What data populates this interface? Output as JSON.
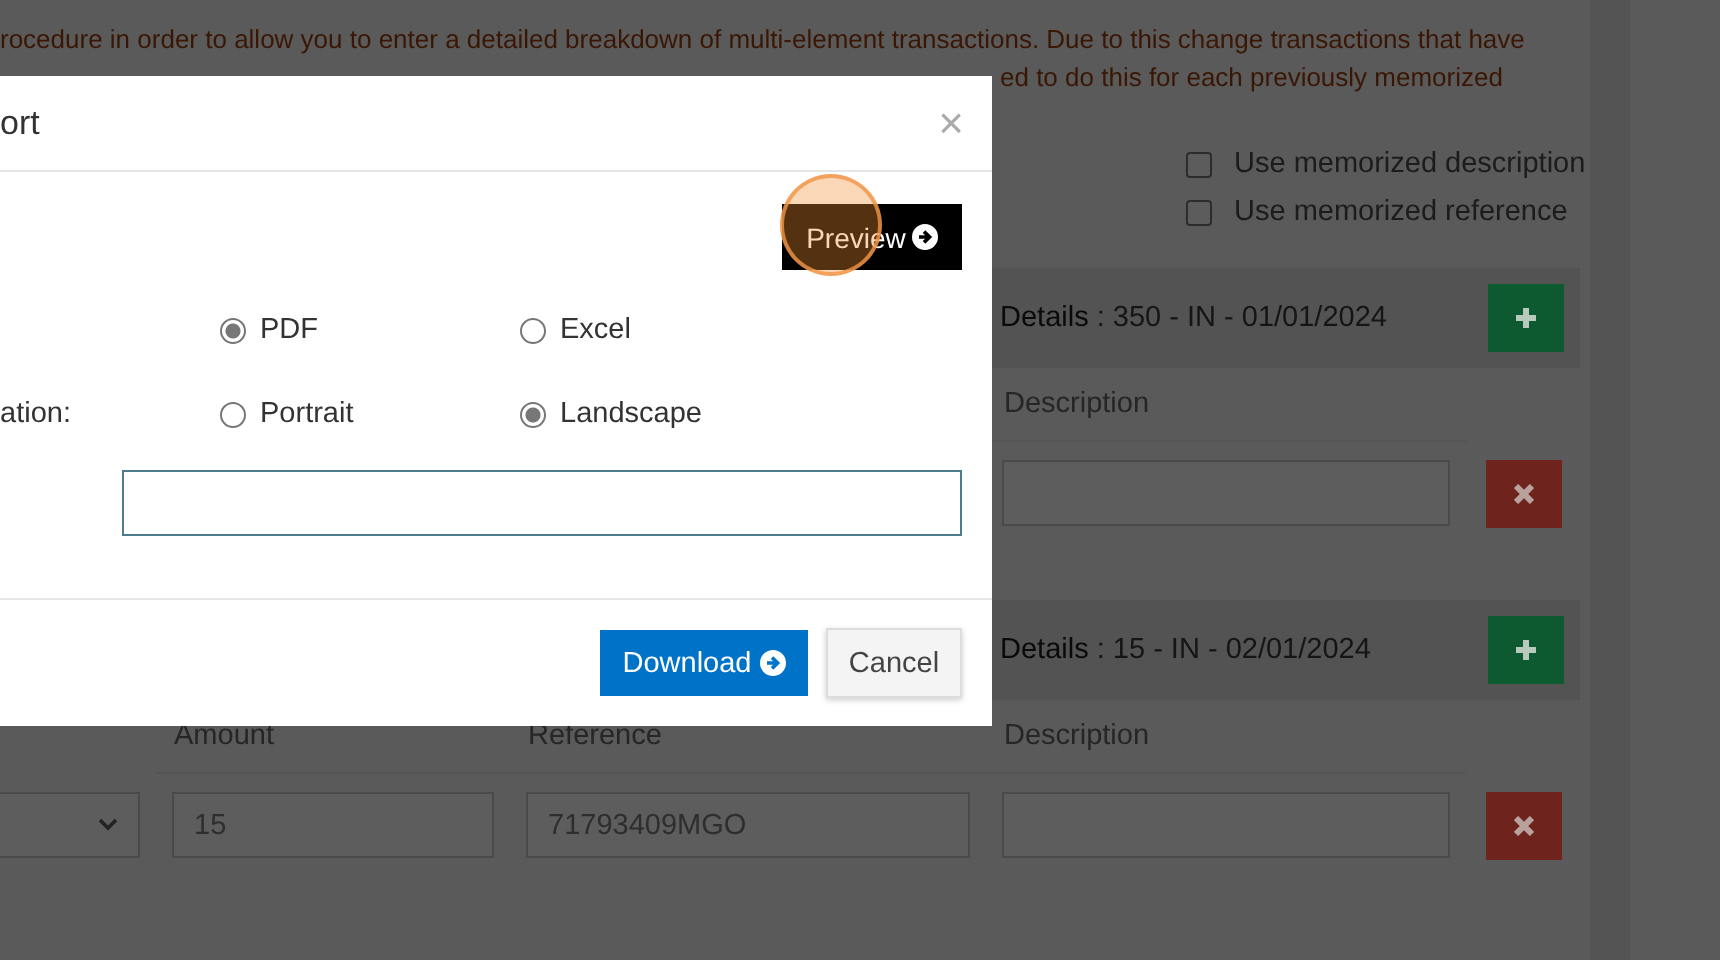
{
  "background": {
    "notice_lines": [
      "rocedure in order to allow you to enter a detailed breakdown of multi-element transactions. Due to this change transactions that have",
      "ed to do this for each previously memorized"
    ],
    "options": [
      {
        "label": "Use memorized description",
        "checked": false
      },
      {
        "label": "Use memorized reference",
        "checked": false
      }
    ],
    "panels": [
      {
        "title": "**Details** : 350 - IN - 01/01/2024",
        "columns": [
          {
            "kind": "description",
            "label": "Description"
          }
        ],
        "cells": [
          {
            "kind": "description"
          }
        ]
      },
      {
        "title": "**Details** : 15 - IN - 02/01/2024",
        "columns": [
          {
            "kind": "amount",
            "label": "Amount"
          },
          {
            "kind": "reference",
            "label": "Reference"
          },
          {
            "kind": "description",
            "label": "Description"
          }
        ],
        "cells": [
          {
            "kind": "select"
          },
          {
            "kind": "amount",
            "value": "15"
          },
          {
            "kind": "reference",
            "value": "71793409MGO"
          },
          {
            "kind": "description"
          }
        ]
      }
    ]
  },
  "modal": {
    "title": "ort",
    "close": "×",
    "preview_button": "Preview",
    "groups": [
      {
        "options": [
          {
            "label": "PDF",
            "selected": true
          },
          {
            "label": "Excel",
            "selected": false
          }
        ]
      },
      {
        "label": "ation:",
        "options": [
          {
            "label": "Portrait",
            "selected": false
          },
          {
            "label": "Landscape",
            "selected": true
          }
        ]
      }
    ],
    "buttons": [
      {
        "kind": "primary",
        "label": "Download"
      },
      {
        "kind": "secondary",
        "label": "Cancel"
      }
    ]
  }
}
